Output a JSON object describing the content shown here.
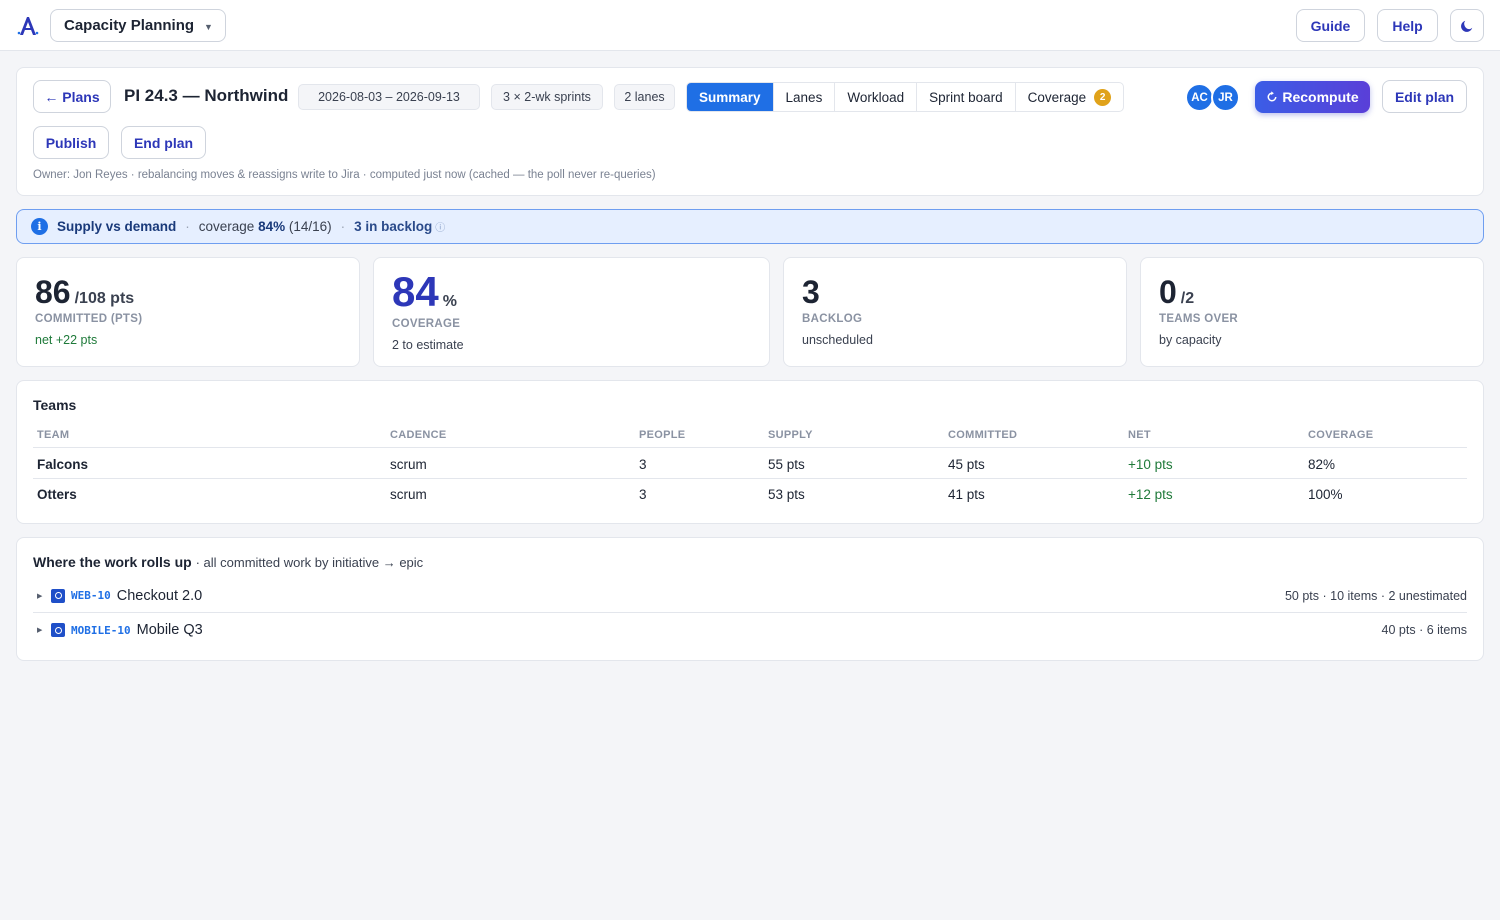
{
  "topbar": {
    "app_name": "Capacity Planning",
    "guide_label": "Guide",
    "help_label": "Help",
    "theme_icon": "moon-icon"
  },
  "plan": {
    "back_label": "← Plans",
    "title": "PI 24.3 — Northwind",
    "date_range": "2026-08-03 – 2026-09-13",
    "sprints": "3 × 2-wk sprints",
    "lanes": "2 lanes",
    "tabs": [
      {
        "label": "Summary",
        "active": true
      },
      {
        "label": "Lanes"
      },
      {
        "label": "Workload"
      },
      {
        "label": "Sprint board"
      },
      {
        "label": "Coverage",
        "badge": "2"
      }
    ],
    "avatars": [
      "AC",
      "JR"
    ],
    "recompute_label": "Recompute",
    "recompute_icon": "refresh-icon",
    "edit_label": "Edit plan",
    "publish_label": "Publish",
    "end_label": "End plan",
    "meta": "Owner: Jon Reyes · rebalancing moves & reassigns write to Jira · computed just now (cached — the poll never re-queries)"
  },
  "banner": {
    "title": "Supply vs demand",
    "coverage_prefix": "coverage",
    "coverage_value": "84%",
    "coverage_ratio": "(14/16)",
    "backlog": "3 in backlog",
    "backlog_info_glyph": "ⓘ"
  },
  "kpis": [
    {
      "value": "86",
      "suffix": "/108 pts",
      "label": "COMMITTED (PTS)",
      "sub": "net +22 pts",
      "sub_color": "#1f7a3a"
    },
    {
      "value": "84",
      "suffix": "%",
      "label": "COVERAGE",
      "sub": "2 to estimate"
    },
    {
      "value": "3",
      "suffix": "",
      "label": "BACKLOG",
      "sub": "unscheduled"
    },
    {
      "value": "0",
      "suffix": "/2",
      "label": "TEAMS OVER",
      "sub": "by capacity"
    }
  ],
  "teams": {
    "title": "Teams",
    "columns": [
      "TEAM",
      "CADENCE",
      "PEOPLE",
      "SUPPLY",
      "COMMITTED",
      "NET",
      "COVERAGE"
    ],
    "rows": [
      {
        "team": "Falcons",
        "cadence": "scrum",
        "people": "3",
        "supply": "55 pts",
        "committed": "45 pts",
        "net": "+10 pts",
        "coverage": "82%"
      },
      {
        "team": "Otters",
        "cadence": "scrum",
        "people": "3",
        "supply": "53 pts",
        "committed": "41 pts",
        "net": "+12 pts",
        "coverage": "100%"
      }
    ]
  },
  "rollup": {
    "title": "Where the work rolls up",
    "subtitle": "· all committed work by initiative → epic",
    "items": [
      {
        "key": "WEB-10",
        "name": "Checkout 2.0",
        "stats": "50 pts · 10 items · 2 unestimated"
      },
      {
        "key": "MOBILE-10",
        "name": "Mobile Q3",
        "stats": "40 pts · 6 items"
      }
    ]
  },
  "colors": {
    "accent": "#2d37b8",
    "primary": "#1f6fe5",
    "positive": "#1f7a3a",
    "badge": "#e0a21a"
  }
}
